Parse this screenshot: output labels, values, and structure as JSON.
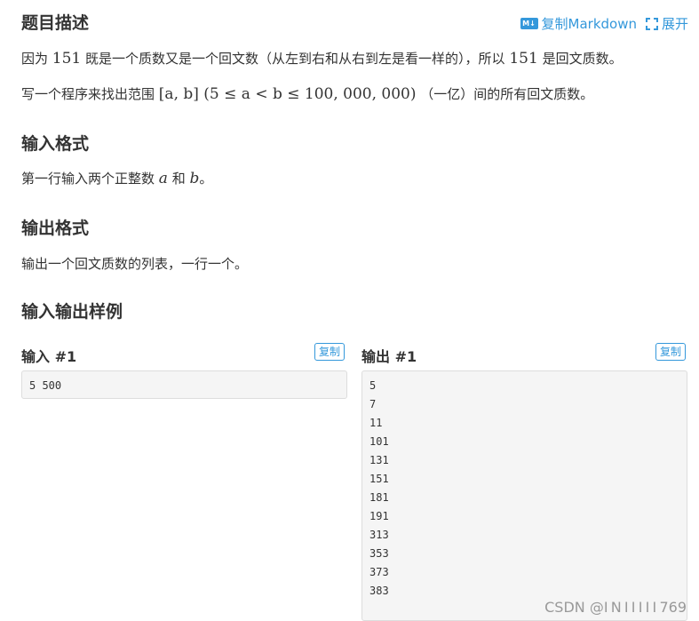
{
  "header": {
    "title": "题目描述",
    "copy_markdown": "复制Markdown",
    "expand": "展开",
    "md_icon": "M↓"
  },
  "description": {
    "p1_a": "因为",
    "p1_n1": "151",
    "p1_b": "既是一个质数又是一个回文数（从左到右和从右到左是看一样的），所以",
    "p1_n2": "151",
    "p1_c": "是回文质数。",
    "p2_a": "写一个程序来找出范围",
    "p2_math": "[a, b] (5 ≤ a < b ≤ 100, 000, 000)",
    "p2_b": "（一亿）间的所有回文质数。"
  },
  "input_format": {
    "title": "输入格式",
    "text_a": "第一行输入两个正整数",
    "var_a": "a",
    "text_b": "和",
    "var_b": "b",
    "text_c": "。"
  },
  "output_format": {
    "title": "输出格式",
    "text": "输出一个回文质数的列表，一行一个。"
  },
  "samples": {
    "title": "输入输出样例",
    "input_label": "输入 #1",
    "output_label": "输出 #1",
    "copy_label": "复制",
    "input_lines": [
      "5 500"
    ],
    "output_lines": [
      "5",
      "7",
      "11",
      "101",
      "131",
      "151",
      "181",
      "191",
      "313",
      "353",
      "373",
      "383"
    ]
  },
  "watermark": "CSDN @I N I I I I I 769"
}
